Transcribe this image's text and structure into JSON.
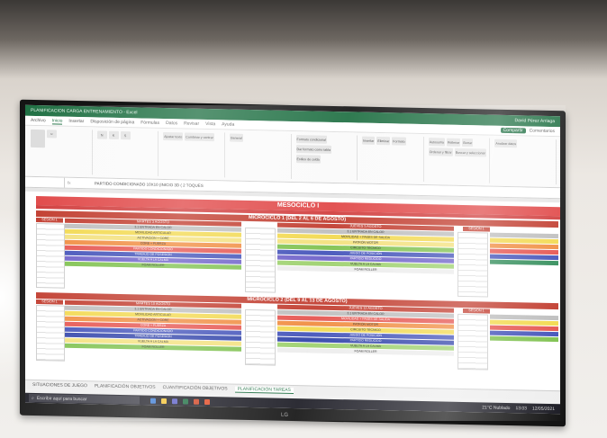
{
  "titlebar": {
    "doc_title": "PLANIFICACION CARGA ENTRENAMIENTO - Excel",
    "user": "David Pérez Arriaga"
  },
  "ribbon_tabs": [
    "Archivo",
    "Inicio",
    "Insertar",
    "Disposición de página",
    "Fórmulas",
    "Datos",
    "Revisar",
    "Vista",
    "Ayuda"
  ],
  "ribbon_actions": {
    "share": "Compartir",
    "comments": "Comentarios"
  },
  "ribbon_buttons": [
    "Ajustar texto",
    "Combinar y centrar",
    "General",
    "Formato condicional",
    "Dar formato como tabla",
    "Estilos de celda",
    "Insertar",
    "Eliminar",
    "Formato",
    "Autosuma",
    "Rellenar",
    "Borrar",
    "Ordenar y filtrar",
    "Buscar y seleccionar",
    "Analizar datos"
  ],
  "formula_bar": {
    "fx": "fx",
    "content": "PARTIDO CONDICIONADO 10X10 (INICIO 3D ( 2 TOQUES"
  },
  "sheet": {
    "mesociclo": "MESOCICLO I",
    "micro1": "MICROCICLO 1 (DEL 2 AL 6 DE AGOSTO)",
    "micro2": "MICROCICLO 2 (DEL 9 AL 13 DE AGOSTO)",
    "session_label": "SESION 1",
    "day_mon": "MARTES 3 AGOSTO",
    "day_thu": "JUEVES 5 AGOSTO",
    "day_mon2": "MARTES 10 AGOSTO",
    "day_thu2": "JUEVES 12 AGOSTO",
    "rows_left": [
      "3.1 ENTRADA EN CALOR",
      "MOVILIDAD ARTICULAR",
      "ACTIVACIÓN + CORE",
      "CORE + FUERZA",
      "PARTIDO CONDICIONADO",
      "TRABAJO DE POSESIÓN",
      "VUELTA A LA CALMA",
      "FOAM ROLLER"
    ],
    "rows_right": [
      "3.1 ENTRADA EN CALOR",
      "MOVILIDAD + PASES DE SALIDA",
      "PATRÓN MOTOR",
      "CIRCUITO TÉCNICO",
      "JUEGO DE POSICIÓN",
      "PARTIDO REDUCIDO",
      "VUELTA A LA CALMA",
      "FOAM ROLLER"
    ]
  },
  "sheet_tabs": [
    "SITUACIONES DE JUEGO",
    "PLANIFICACIÓN OBJETIVOS",
    "CUANTIFICACIÓN OBJETIVOS",
    "PLANIFICACIÓN TAREAS"
  ],
  "taskbar": {
    "search": "Escribir aquí para buscar",
    "weather": "21°C Nublado",
    "time": "13:03",
    "date": "12/05/2021"
  },
  "colors": {
    "excel_green": "#1e6f42",
    "meso_red": "#e04444"
  }
}
